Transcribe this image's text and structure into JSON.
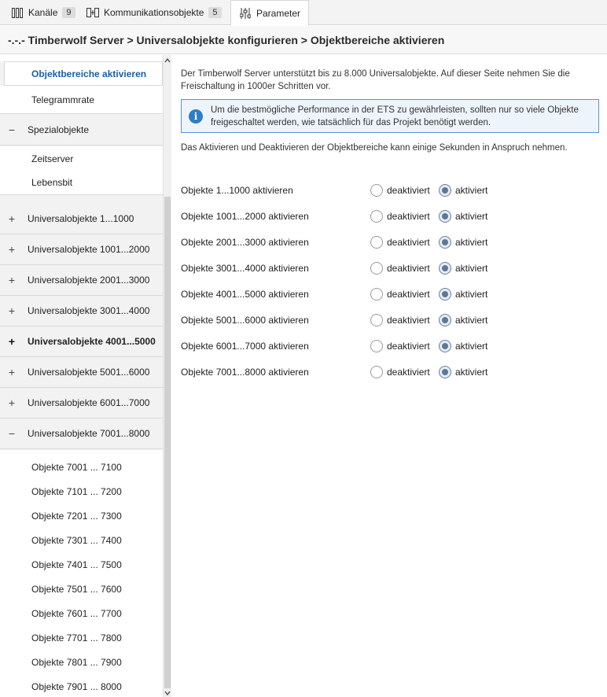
{
  "tabs": [
    {
      "label": "Kanäle",
      "badge": "9",
      "icon": "columns-icon"
    },
    {
      "label": "Kommunikationsobjekte",
      "badge": "5",
      "icon": "object-link-icon"
    },
    {
      "label": "Parameter",
      "badge": "",
      "icon": "sliders-icon"
    }
  ],
  "breadcrumb": "-.-.- Timberwolf Server > Universalobjekte konfigurieren > Objektbereiche aktivieren",
  "sidebar": {
    "selected": "Objektbereiche aktivieren",
    "telegrammrate": "Telegrammrate",
    "spezial": "Spezialobjekte",
    "spezial_children": [
      "Zeitserver",
      "Lebensbit"
    ],
    "groups": [
      {
        "label": "Universalobjekte 1...1000",
        "sign": "+"
      },
      {
        "label": "Universalobjekte 1001...2000",
        "sign": "+"
      },
      {
        "label": "Universalobjekte 2001...3000",
        "sign": "+"
      },
      {
        "label": "Universalobjekte 3001...4000",
        "sign": "+"
      },
      {
        "label": "Universalobjekte 4001...5000",
        "sign": "+"
      },
      {
        "label": "Universalobjekte 5001...6000",
        "sign": "+"
      },
      {
        "label": "Universalobjekte 6001...7000",
        "sign": "+"
      },
      {
        "label": "Universalobjekte 7001...8000",
        "sign": "−"
      }
    ],
    "sub_items": [
      "Objekte 7001 ... 7100",
      "Objekte 7101 ... 7200",
      "Objekte 7201 ... 7300",
      "Objekte 7301 ... 7400",
      "Objekte 7401 ... 7500",
      "Objekte 7501 ... 7600",
      "Objekte 7601 ... 7700",
      "Objekte 7701 ... 7800",
      "Objekte 7801 ... 7900",
      "Objekte 7901 ... 8000"
    ],
    "minus_sign": "−"
  },
  "content": {
    "intro": "Der Timberwolf Server unterstützt bis zu 8.000 Universalobjekte. Auf dieser Seite nehmen Sie die Freischaltung in 1000er Schritten vor.",
    "info": "Um die bestmögliche Performance in der ETS zu gewährleisten, sollten nur so viele Objekte freigeschaltet werden, wie tatsächlich für das Projekt benötigt werden.",
    "note": "Das Aktivieren und Deaktivieren der Objektbereiche kann einige Sekunden in Anspruch nehmen.",
    "option_off": "deaktiviert",
    "option_on": "aktiviert",
    "rows": [
      {
        "label": "Objekte 1...1000 aktivieren",
        "value": "aktiviert"
      },
      {
        "label": "Objekte 1001...2000 aktivieren",
        "value": "aktiviert"
      },
      {
        "label": "Objekte 2001...3000 aktivieren",
        "value": "aktiviert"
      },
      {
        "label": "Objekte 3001...4000 aktivieren",
        "value": "aktiviert"
      },
      {
        "label": "Objekte 4001...5000 aktivieren",
        "value": "aktiviert"
      },
      {
        "label": "Objekte 5001...6000 aktivieren",
        "value": "aktiviert"
      },
      {
        "label": "Objekte 6001...7000 aktivieren",
        "value": "aktiviert"
      },
      {
        "label": "Objekte 7001...8000 aktivieren",
        "value": "aktiviert"
      }
    ]
  }
}
